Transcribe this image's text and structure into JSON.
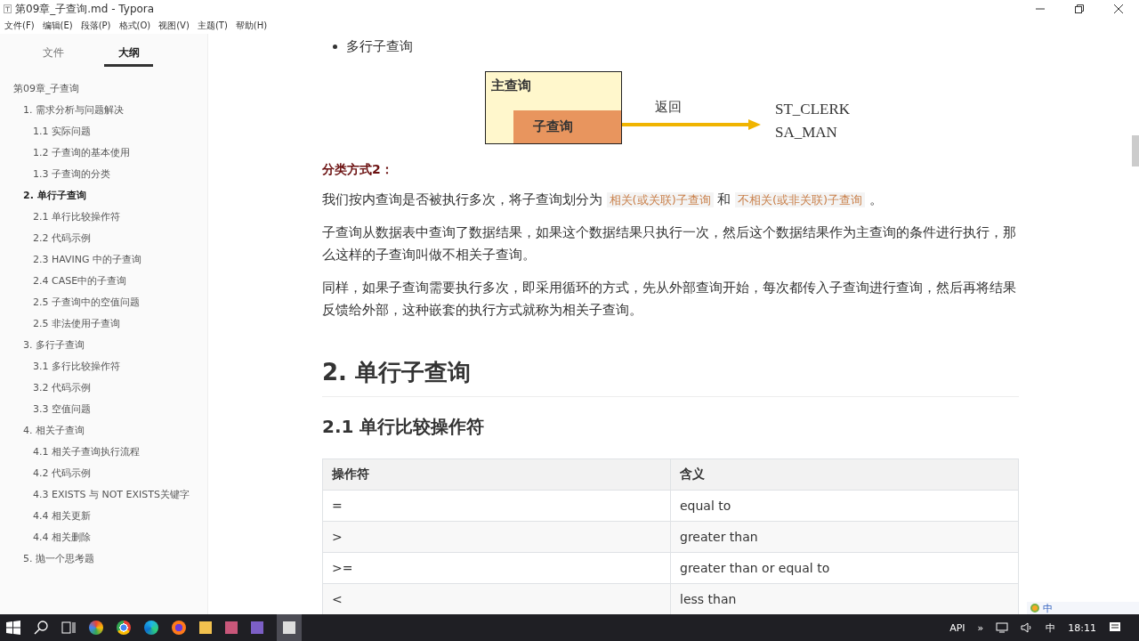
{
  "window": {
    "title": "第09章_子查询.md - Typora"
  },
  "menu": [
    "文件(F)",
    "编辑(E)",
    "段落(P)",
    "格式(O)",
    "视图(V)",
    "主题(T)",
    "帮助(H)"
  ],
  "sidebar": {
    "tabs": [
      {
        "label": "文件",
        "selected": false
      },
      {
        "label": "大纲",
        "selected": true
      }
    ],
    "outline": [
      {
        "label": "第09章_子查询",
        "selected": false,
        "children": [
          {
            "label": "1. 需求分析与问题解决",
            "selected": false,
            "children": [
              {
                "label": "1.1 实际问题",
                "selected": false
              },
              {
                "label": "1.2 子查询的基本使用",
                "selected": false
              },
              {
                "label": "1.3 子查询的分类",
                "selected": false
              }
            ]
          },
          {
            "label": "2. 单行子查询",
            "selected": true,
            "children": [
              {
                "label": "2.1 单行比较操作符",
                "selected": false
              },
              {
                "label": "2.2 代码示例",
                "selected": false
              },
              {
                "label": "2.3 HAVING 中的子查询",
                "selected": false
              },
              {
                "label": "2.4 CASE中的子查询",
                "selected": false
              },
              {
                "label": "2.5 子查询中的空值问题",
                "selected": false
              },
              {
                "label": "2.5 非法使用子查询",
                "selected": false
              }
            ]
          },
          {
            "label": "3. 多行子查询",
            "selected": false,
            "children": [
              {
                "label": "3.1 多行比较操作符",
                "selected": false
              },
              {
                "label": "3.2 代码示例",
                "selected": false
              },
              {
                "label": "3.3 空值问题",
                "selected": false
              }
            ]
          },
          {
            "label": "4. 相关子查询",
            "selected": false,
            "children": [
              {
                "label": "4.1 相关子查询执行流程",
                "selected": false
              },
              {
                "label": "4.2 代码示例",
                "selected": false
              },
              {
                "label": "4.3 EXISTS 与 NOT EXISTS关键字",
                "selected": false
              },
              {
                "label": "4.4 相关更新",
                "selected": false
              },
              {
                "label": "4.4 相关删除",
                "selected": false
              }
            ]
          },
          {
            "label": "5. 抛一个思考题",
            "selected": false
          }
        ]
      }
    ]
  },
  "content": {
    "bullet": "多行子查询",
    "diagram": {
      "outer": "主查询",
      "inner": "子查询",
      "arrow_label": "返回",
      "results": [
        "ST_CLERK",
        "SA_MAN"
      ]
    },
    "subheading": "分类方式2：",
    "paragraphs": [
      [
        {
          "kind": "text",
          "text": "我们按内查询是否被执行多次，将子查询划分为 "
        },
        {
          "kind": "code",
          "text": "相关(或关联)子查询"
        },
        {
          "kind": "text",
          "text": " 和 "
        },
        {
          "kind": "code",
          "text": "不相关(或非关联)子查询"
        },
        {
          "kind": "text",
          "text": " 。"
        }
      ],
      [
        {
          "kind": "text",
          "text": "子查询从数据表中查询了数据结果，如果这个数据结果只执行一次，然后这个数据结果作为主查询的条件进行执行，那么这样的子查询叫做不相关子查询。"
        }
      ],
      [
        {
          "kind": "text",
          "text": "同样，如果子查询需要执行多次，即采用循环的方式，先从外部查询开始，每次都传入子查询进行查询，然后再将结果反馈给外部，这种嵌套的执行方式就称为相关子查询。"
        }
      ]
    ],
    "h1": "2. 单行子查询",
    "h2": "2.1 单行比较操作符",
    "table": {
      "columns": [
        "操作符",
        "含义"
      ],
      "rows": [
        [
          "=",
          "equal to"
        ],
        [
          ">",
          "greater than"
        ],
        [
          ">=",
          "greater than or equal to"
        ],
        [
          "<",
          "less than"
        ]
      ]
    }
  },
  "ime": {
    "mode": "中"
  },
  "taskbar": {
    "tray": [
      "API",
      "»",
      "中",
      "18:11"
    ]
  }
}
